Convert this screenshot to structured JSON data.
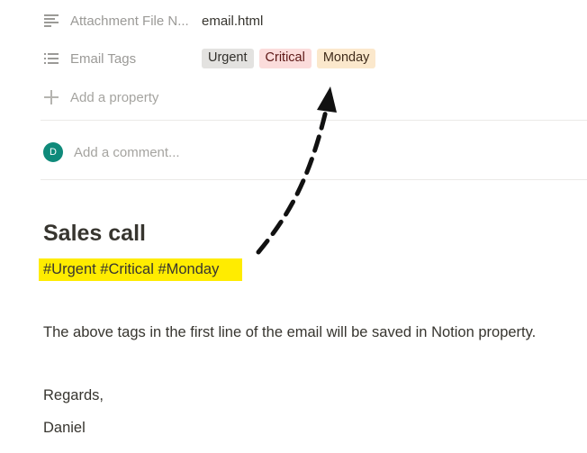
{
  "properties": [
    {
      "name": "Attachment File N...",
      "icon": "text-lines-icon",
      "value": "email.html"
    },
    {
      "name": "Email Tags",
      "icon": "list-icon"
    }
  ],
  "tags": [
    {
      "label": "Urgent",
      "bg": "#e3e2e0",
      "fg": "#32302c"
    },
    {
      "label": "Critical",
      "bg": "#fbdcdb",
      "fg": "#5d1715"
    },
    {
      "label": "Monday",
      "bg": "#fbe8cc",
      "fg": "#402c1b"
    }
  ],
  "add_property": {
    "label": "Add a property"
  },
  "comment": {
    "avatar_initial": "D",
    "placeholder": "Add a comment..."
  },
  "document": {
    "heading": "Sales call",
    "highlighted_tags": "#Urgent #Critical #Monday",
    "highlight_color": "#ffec00",
    "paragraph": "The above tags in the first line of the email will be saved in Notion property.",
    "closing": "Regards,",
    "signature": "Daniel"
  }
}
